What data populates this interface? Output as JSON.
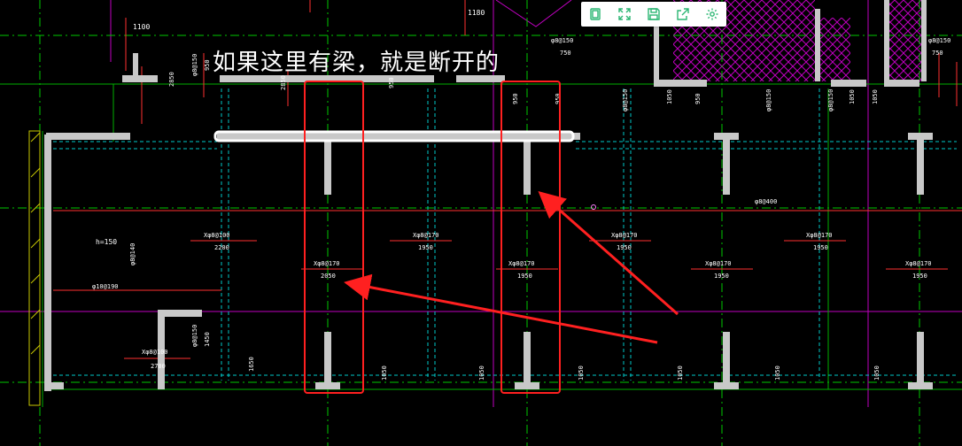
{
  "annotation": {
    "text": "如果这里有梁，就是断开的"
  },
  "toolbar": {
    "buttons": [
      {
        "name": "fit-page-icon"
      },
      {
        "name": "fullscreen-icon"
      },
      {
        "name": "save-icon"
      },
      {
        "name": "share-icon"
      },
      {
        "name": "settings-icon"
      }
    ],
    "icon_color": "#2bb673"
  },
  "drawing": {
    "top_dims": [
      "1100",
      "1180",
      "750",
      "750",
      "1050",
      "1050",
      "1050"
    ],
    "rebar_top": [
      "φ8@150",
      "φ8@150",
      "φ8@150",
      "φ8@150",
      "φ8@150",
      "φ8@150"
    ],
    "dims_950": [
      "950",
      "950",
      "950",
      "950",
      "950"
    ],
    "dims_2850": [
      "2850",
      "2850"
    ],
    "rebar_400": "φ8@400",
    "h_label": "h=150",
    "rebar_140": "φ8@140",
    "rebar_190": "φ10@190",
    "spans_top": [
      {
        "rebar": "Xφ8@100",
        "dim": "2200"
      },
      {
        "rebar": "Xφ8@170",
        "dim": "1950"
      },
      {
        "rebar": "Xφ8@170",
        "dim": "1950"
      },
      {
        "rebar": "Xφ8@170",
        "dim": "1950"
      }
    ],
    "spans_mid": [
      {
        "rebar": "Xφ8@170",
        "dim": "2050"
      },
      {
        "rebar": "Xφ8@170",
        "dim": "1950"
      },
      {
        "rebar": "Xφ8@170",
        "dim": "1950"
      },
      {
        "rebar": "Xφ8@170",
        "dim": "1950"
      }
    ],
    "lower_left": {
      "rebar": "Xφ8@100",
      "dim": "2700",
      "rebar2": "φ8@150",
      "dim2": "1450",
      "dim3": "1650"
    },
    "bottom_dims": [
      "1050",
      "1050",
      "1050",
      "1050",
      "1050",
      "1050"
    ]
  },
  "colors": {
    "background": "#000000",
    "wall": "#c8c8c8",
    "axis_green": "#00c800",
    "beam_cyan": "#00c8c8",
    "grid_magenta": "#c000c0",
    "dim_red": "#ff3030",
    "annotation_red": "#ff2020",
    "highlight": "#ffffff"
  }
}
